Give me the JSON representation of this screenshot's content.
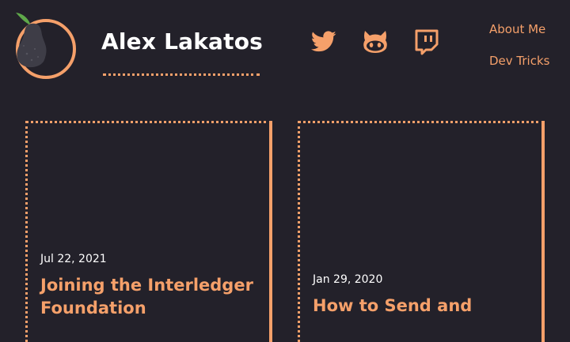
{
  "site": {
    "title": "Alex Lakatos"
  },
  "social": [
    {
      "name": "twitter-icon"
    },
    {
      "name": "github-icon"
    },
    {
      "name": "twitch-icon"
    }
  ],
  "nav": {
    "about": "About Me",
    "dev_tricks": "Dev Tricks"
  },
  "posts": [
    {
      "date": "Jul 22, 2021",
      "title": "Joining the Interledger Foundation"
    },
    {
      "date": "Jan 29, 2020",
      "title": "How to Send and"
    }
  ],
  "colors": {
    "background": "#23212a",
    "accent": "#f5a06a",
    "text": "#ffffff"
  }
}
